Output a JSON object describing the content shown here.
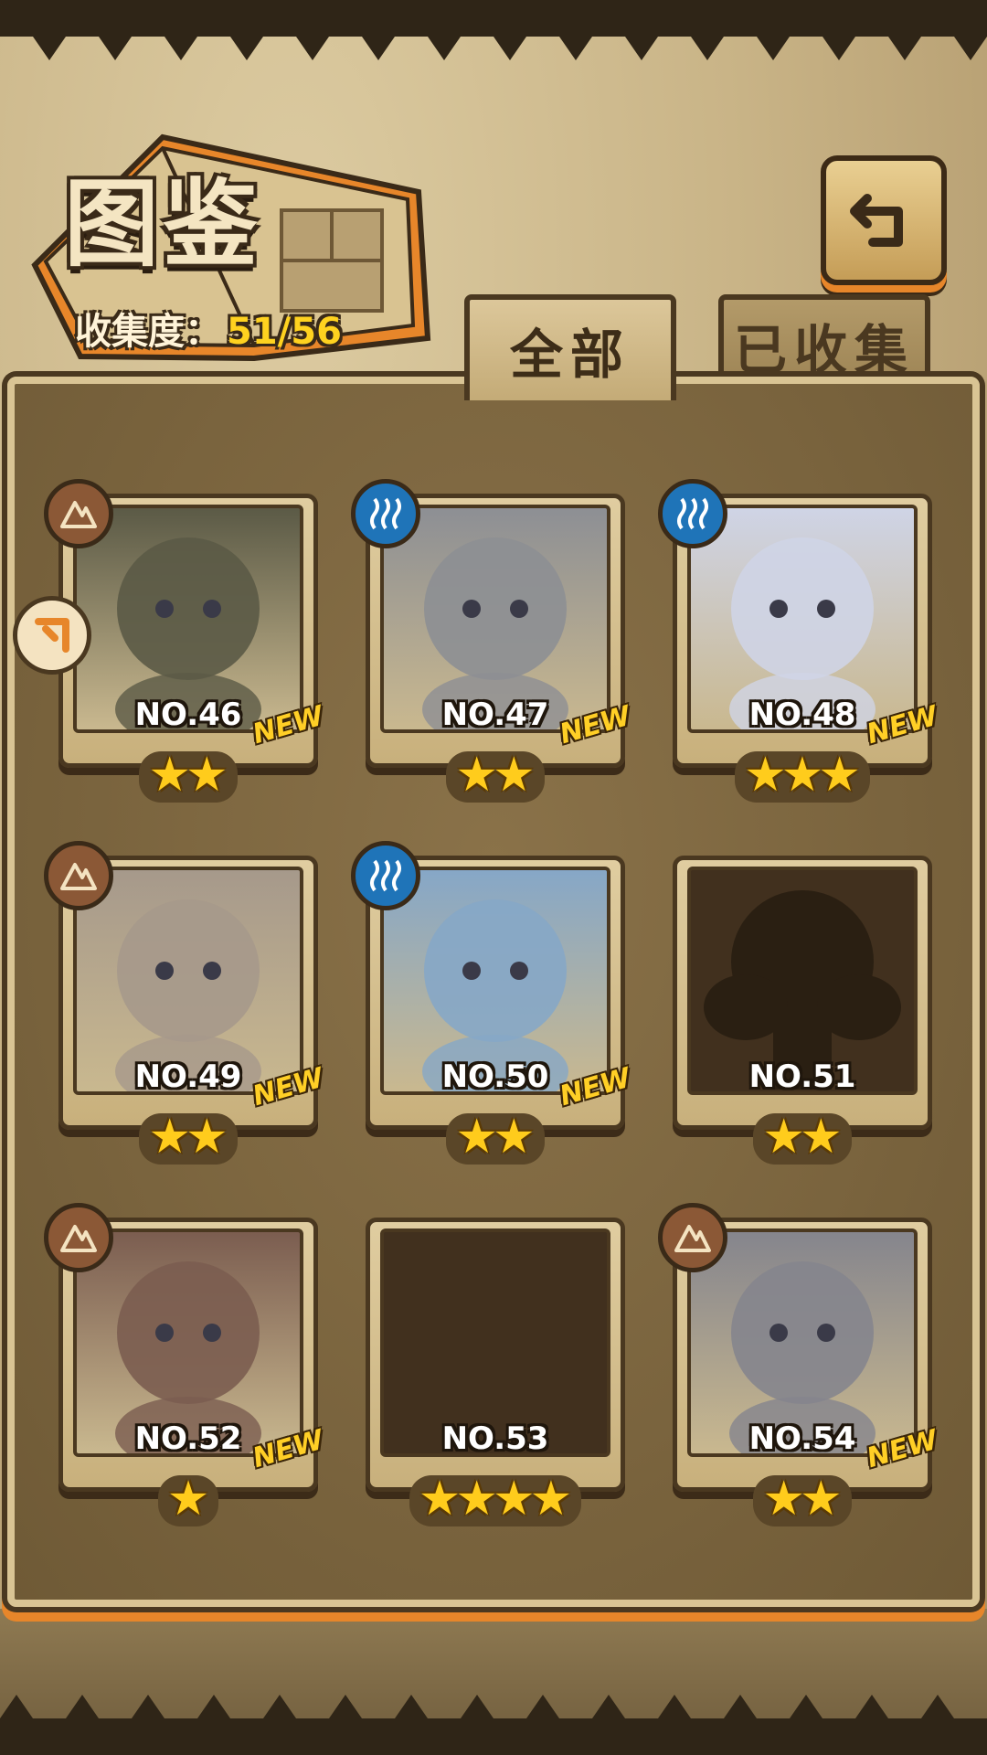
{
  "header": {
    "title": "图鉴",
    "collection_label": "收集度：",
    "collection_value": "51/56"
  },
  "tabs": [
    {
      "label": "全部",
      "active": true
    },
    {
      "label": "已收集",
      "active": false
    }
  ],
  "colors": {
    "earth_badge": "#8b5836",
    "water_badge": "#1f74b8",
    "star": "#ffcc1c",
    "new_tag": "#ffcf26"
  },
  "cards": [
    {
      "no": "NO.46",
      "element": "earth",
      "new": "NEW",
      "stars": "★★",
      "star_count": 2,
      "locked": false
    },
    {
      "no": "NO.47",
      "element": "water",
      "new": "NEW",
      "stars": "★★",
      "star_count": 2,
      "locked": false
    },
    {
      "no": "NO.48",
      "element": "water",
      "new": "NEW",
      "stars": "★★★",
      "star_count": 3,
      "locked": false
    },
    {
      "no": "NO.49",
      "element": "earth",
      "new": "NEW",
      "stars": "★★",
      "star_count": 2,
      "locked": false
    },
    {
      "no": "NO.50",
      "element": "water",
      "new": "NEW",
      "stars": "★★",
      "star_count": 2,
      "locked": false
    },
    {
      "no": "NO.51",
      "element": "",
      "new": "",
      "stars": "★★",
      "star_count": 2,
      "locked": true
    },
    {
      "no": "NO.52",
      "element": "earth",
      "new": "NEW",
      "stars": "★",
      "star_count": 1,
      "locked": false
    },
    {
      "no": "NO.53",
      "element": "",
      "new": "",
      "stars": "★★★★",
      "star_count": 4,
      "locked": true
    },
    {
      "no": "NO.54",
      "element": "earth",
      "new": "NEW",
      "stars": "★★",
      "star_count": 2,
      "locked": false
    }
  ]
}
